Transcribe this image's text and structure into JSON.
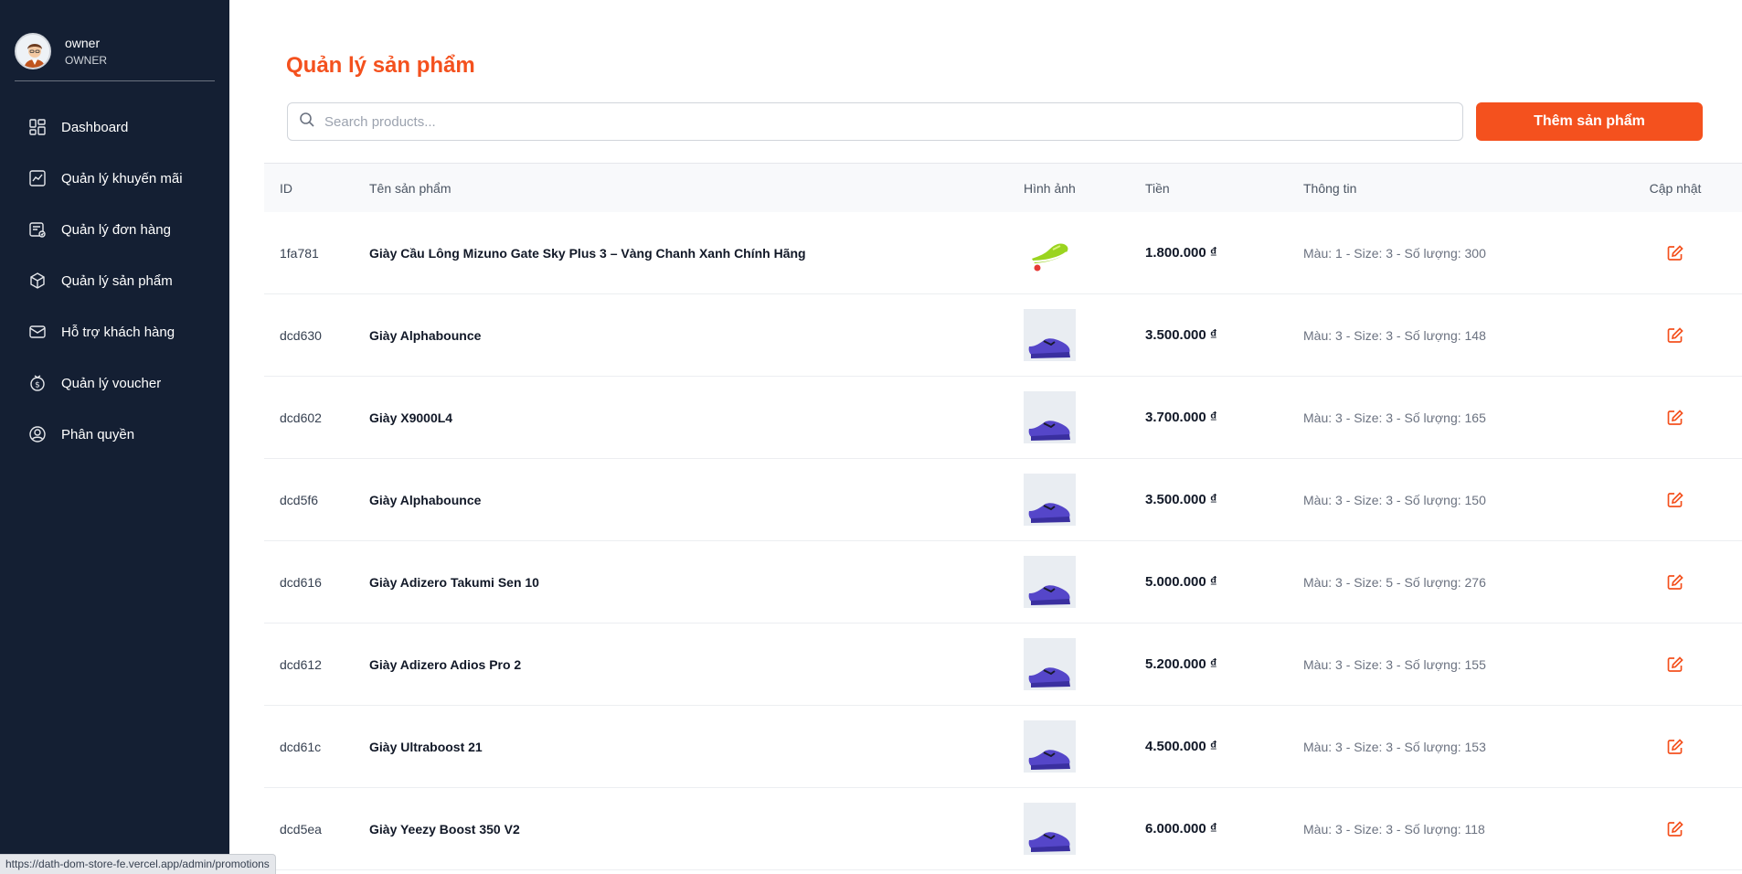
{
  "user": {
    "name": "owner",
    "role": "OWNER"
  },
  "sidebar": {
    "items": [
      {
        "label": "Dashboard",
        "icon": "dashboard-icon"
      },
      {
        "label": "Quản lý khuyến mãi",
        "icon": "trend-chart-icon"
      },
      {
        "label": "Quản lý đơn hàng",
        "icon": "order-icon"
      },
      {
        "label": "Quản lý sản phẩm",
        "icon": "box-icon"
      },
      {
        "label": "Hỗ trợ khách hàng",
        "icon": "mail-icon"
      },
      {
        "label": "Quản lý voucher",
        "icon": "coin-icon"
      },
      {
        "label": "Phân quyền",
        "icon": "user-circle-icon"
      }
    ]
  },
  "page": {
    "title": "Quản lý sản phẩm",
    "search_placeholder": "Search products...",
    "add_button": "Thêm sản phẩm"
  },
  "table": {
    "headers": {
      "id": "ID",
      "name": "Tên sản phẩm",
      "image": "Hình ảnh",
      "price": "Tiền",
      "info": "Thông tin",
      "update": "Cập nhật"
    },
    "rows": [
      {
        "id": "1fa781",
        "name": "Giày Cầu Lông Mizuno Gate Sky Plus 3 – Vàng Chanh Xanh Chính Hãng",
        "price": "1.800.000 ₫",
        "info": "Màu: 1 - Size: 3 - Số lượng: 300",
        "image": "yellow-shoe"
      },
      {
        "id": "dcd630",
        "name": "Giày Alphabounce",
        "price": "3.500.000 ₫",
        "info": "Màu: 3 - Size: 3 - Số lượng: 148",
        "image": "purple-shoe"
      },
      {
        "id": "dcd602",
        "name": "Giày X9000L4",
        "price": "3.700.000 ₫",
        "info": "Màu: 3 - Size: 3 - Số lượng: 165",
        "image": "purple-shoe"
      },
      {
        "id": "dcd5f6",
        "name": "Giày Alphabounce",
        "price": "3.500.000 ₫",
        "info": "Màu: 3 - Size: 3 - Số lượng: 150",
        "image": "purple-shoe"
      },
      {
        "id": "dcd616",
        "name": "Giày Adizero Takumi Sen 10",
        "price": "5.000.000 ₫",
        "info": "Màu: 3 - Size: 5 - Số lượng: 276",
        "image": "purple-shoe"
      },
      {
        "id": "dcd612",
        "name": "Giày Adizero Adios Pro 2",
        "price": "5.200.000 ₫",
        "info": "Màu: 3 - Size: 3 - Số lượng: 155",
        "image": "purple-shoe"
      },
      {
        "id": "dcd61c",
        "name": "Giày Ultraboost 21",
        "price": "4.500.000 ₫",
        "info": "Màu: 3 - Size: 3 - Số lượng: 153",
        "image": "purple-shoe"
      },
      {
        "id": "dcd5ea",
        "name": "Giày Yeezy Boost 350 V2",
        "price": "6.000.000 ₫",
        "info": "Màu: 3 - Size: 3 - Số lượng: 118",
        "image": "purple-shoe"
      }
    ]
  },
  "status_url": "https://dath-dom-store-fe.vercel.app/admin/promotions",
  "colors": {
    "accent": "#f4511e",
    "sidebar_bg": "#141f33"
  }
}
